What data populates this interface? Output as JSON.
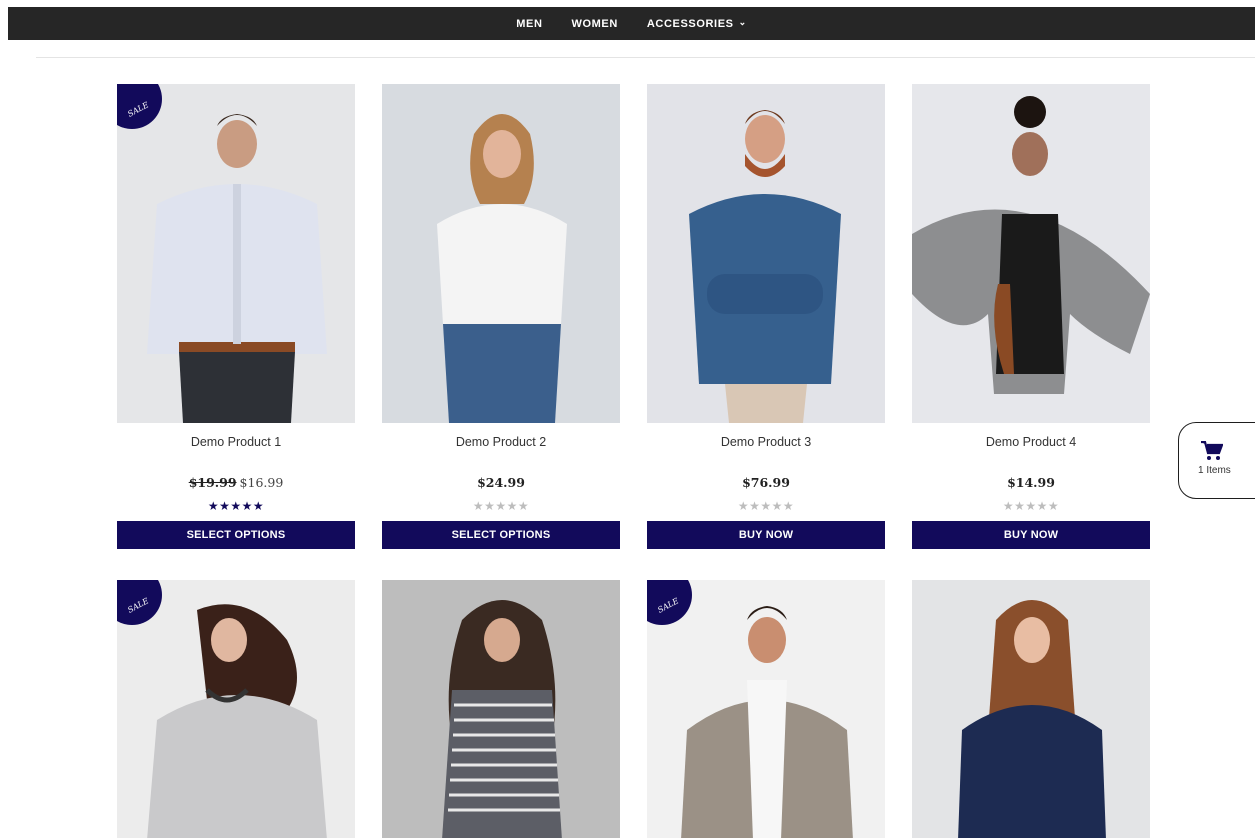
{
  "nav": {
    "items": [
      {
        "label": "MEN"
      },
      {
        "label": "WOMEN"
      },
      {
        "label": "ACCESSORIES",
        "has_dropdown": true
      }
    ]
  },
  "products_row1": [
    {
      "title": "Demo Product 1",
      "sale": true,
      "sale_label": "SALE",
      "old_price": "$19.99",
      "price": "$16.99",
      "rating": "★★★★★",
      "rated": true,
      "button": "SELECT OPTIONS",
      "bg": "#e5e6e8"
    },
    {
      "title": "Demo Product 2",
      "sale": false,
      "price": "$24.99",
      "rating": "★★★★★",
      "rated": false,
      "button": "SELECT OPTIONS",
      "bg": "#d7dbe0"
    },
    {
      "title": "Demo Product 3",
      "sale": false,
      "price": "$76.99",
      "rating": "★★★★★",
      "rated": false,
      "button": "BUY NOW",
      "bg": "#e2e3e8"
    },
    {
      "title": "Demo Product 4",
      "sale": false,
      "price": "$14.99",
      "rating": "★★★★★",
      "rated": false,
      "button": "BUY NOW",
      "bg": "#e6e7eb"
    }
  ],
  "products_row2": [
    {
      "sale": true,
      "sale_label": "SALE",
      "bg": "#ececec"
    },
    {
      "sale": false,
      "bg": "#bdbdbd"
    },
    {
      "sale": true,
      "sale_label": "SALE",
      "bg": "#f1f1f1"
    },
    {
      "sale": false,
      "bg": "#e3e4e6"
    }
  ],
  "cart": {
    "count_label": "1 Items",
    "icon": "cart-icon"
  },
  "colors": {
    "accent": "#120a5b",
    "nav_bg": "#262626"
  }
}
